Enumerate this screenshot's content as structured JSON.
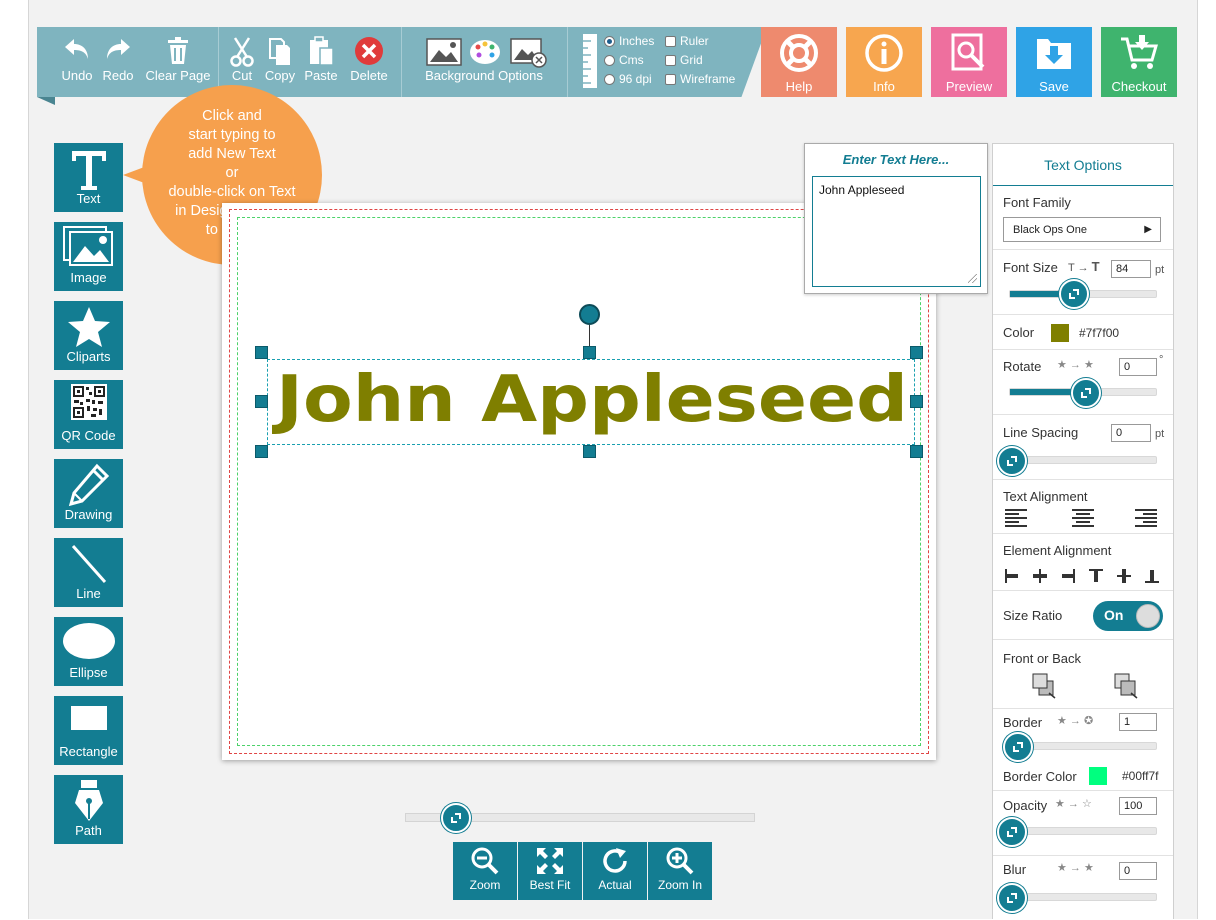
{
  "toolbar": {
    "undo": "Undo",
    "redo": "Redo",
    "clear_page": "Clear Page",
    "cut": "Cut",
    "copy": "Copy",
    "paste": "Paste",
    "delete": "Delete",
    "background_options": "Background Options",
    "units": {
      "inches": "Inches",
      "cms": "Cms",
      "dpi": "96 dpi",
      "selected": "Inches"
    },
    "view": {
      "ruler": "Ruler",
      "grid": "Grid",
      "wireframe": "Wireframe"
    }
  },
  "actions": {
    "help": "Help",
    "info": "Info",
    "preview": "Preview",
    "save": "Save",
    "checkout": "Checkout",
    "colors": {
      "help": "#ee8a6e",
      "info": "#f7a64f",
      "preview": "#ee6f9e",
      "save": "#2fa3e6",
      "checkout": "#3fb46e"
    }
  },
  "tools": {
    "text": "Text",
    "image": "Image",
    "cliparts": "Cliparts",
    "qr_code": "QR Code",
    "drawing": "Drawing",
    "line": "Line",
    "ellipse": "Ellipse",
    "rectangle": "Rectangle",
    "path": "Path"
  },
  "tooltip": {
    "line1": "Click and",
    "line2": "start typing to",
    "line3": "add New Text",
    "line4": "or",
    "line5": "double-click on Text",
    "line6": "in Design Canvas",
    "line7": "to Edit it"
  },
  "canvas": {
    "text": "John Appleseed",
    "text_color": "#7f7f00"
  },
  "enter_text": {
    "title": "Enter Text Here...",
    "value": "John Appleseed"
  },
  "text_options": {
    "title": "Text Options",
    "font_family_label": "Font Family",
    "font_family_value": "Black Ops One",
    "font_size_label": "Font Size",
    "font_size_value": "84",
    "pt": "pt",
    "color_label": "Color",
    "color_value": "#7f7f00",
    "rotate_label": "Rotate",
    "rotate_value": "0",
    "degree": "°",
    "line_spacing_label": "Line Spacing",
    "line_spacing_value": "0",
    "text_alignment_label": "Text Alignment",
    "element_alignment_label": "Element Alignment",
    "size_ratio_label": "Size Ratio",
    "size_ratio_value": "On",
    "front_back_label": "Front or Back",
    "border_label": "Border",
    "border_value": "1",
    "border_color_label": "Border Color",
    "border_color_value": "#00ff7f",
    "opacity_label": "Opacity",
    "opacity_value": "100",
    "blur_label": "Blur",
    "blur_value": "0"
  },
  "zoom": {
    "zoom": "Zoom",
    "best_fit": "Best Fit",
    "actual": "Actual",
    "zoom_in": "Zoom In"
  }
}
